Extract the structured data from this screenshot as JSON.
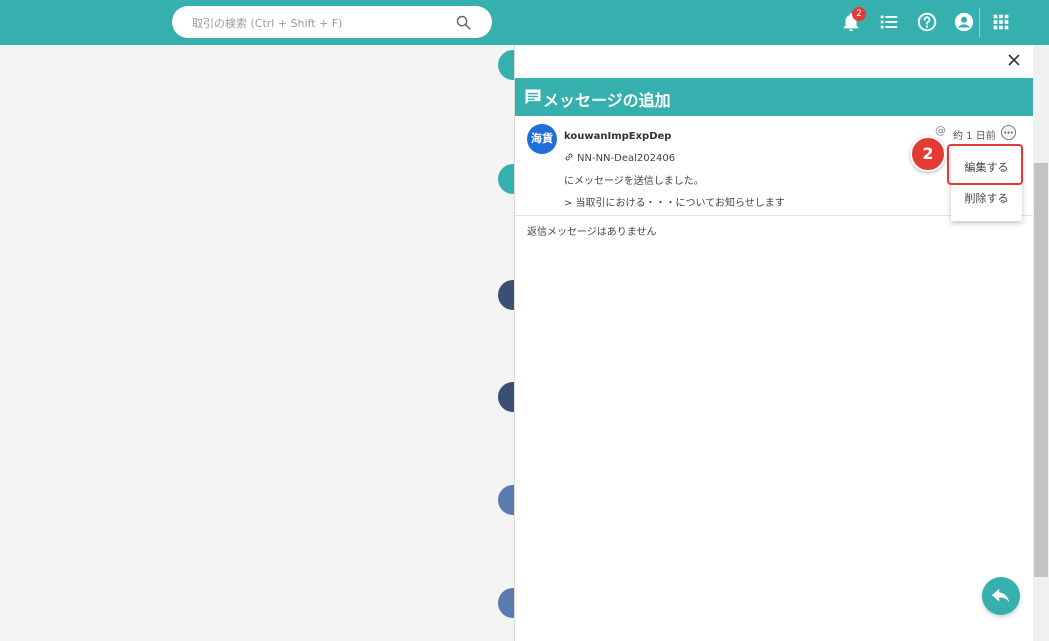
{
  "topbar": {
    "search_placeholder": "取引の検索 (Ctrl + Shift + F)",
    "notification_count": "2",
    "icons": [
      "bell-icon",
      "list-icon",
      "help-icon",
      "account-icon",
      "apps-grid-icon"
    ]
  },
  "panel": {
    "title": "メッセージの追加",
    "message": {
      "avatar_text": "海貨",
      "sender": "kouwanImpExpDep",
      "deal": "NN-NN-Deal202406",
      "line1": "にメッセージを送信しました。",
      "line2": "> 当取引における・・・についてお知らせします",
      "time": "約 1 日前",
      "mention_symbol": "@"
    },
    "no_reply": "返信メッセージはありません"
  },
  "menu": {
    "edit_label": "編集する",
    "delete_label": "削除する"
  },
  "step_marker": "2",
  "colors": {
    "brand": "#35b0ae",
    "avatar": "#1e6fd9",
    "highlight": "#e53935"
  }
}
